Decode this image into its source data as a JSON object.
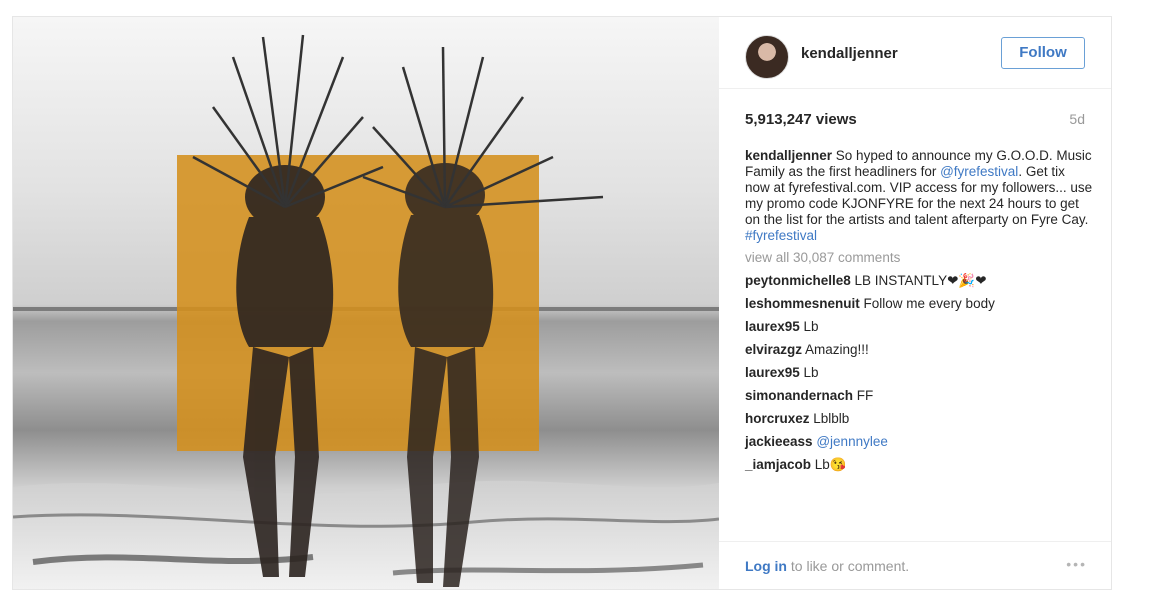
{
  "post": {
    "username": "kendalljenner",
    "follow_label": "Follow",
    "views": "5,913,247 views",
    "age": "5d",
    "caption": {
      "user": "kendalljenner",
      "text_1": " So hyped to announce my G.O.O.D. Music Family as the first headliners for ",
      "mention": "@fyrefestival",
      "text_2": ". Get tix now at fyrefestival.com. VIP access for my followers... use my promo code KJONFYRE for the next 24 hours to get on the list for the artists and talent afterparty on Fyre Cay. ",
      "hashtag": "#fyrefestival"
    },
    "view_all_comments": "view all 30,087 comments",
    "comments": [
      {
        "user": "peytonmichelle8",
        "text": " LB INSTANTLY❤🎉❤"
      },
      {
        "user": "leshommesnenuit",
        "text": " Follow me every body"
      },
      {
        "user": "laurex95",
        "text": " Lb"
      },
      {
        "user": "elvirazgz",
        "text": " Amazing!!!"
      },
      {
        "user": "laurex95",
        "text": " Lb"
      },
      {
        "user": "simonandernach",
        "text": " FF"
      },
      {
        "user": "horcruxez",
        "text": " Lblblb"
      },
      {
        "user": "jackieeass",
        "text": " ",
        "mention": "@jennnylee"
      },
      {
        "user": "_iamjacob",
        "text": " Lb😘"
      }
    ],
    "login_link": "Log in",
    "login_text": " to like or comment.",
    "more_dots": "•••"
  },
  "colors": {
    "accent_overlay": "#d4901c",
    "link_blue": "#3f79c4"
  }
}
